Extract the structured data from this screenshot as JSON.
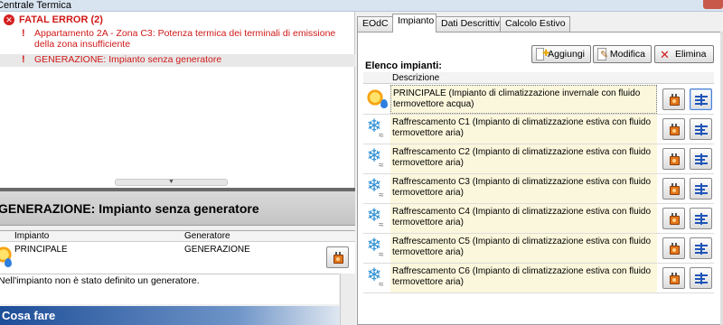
{
  "window": {
    "title": "Centrale Termica"
  },
  "errors": {
    "header": "FATAL ERROR (2)",
    "items": [
      {
        "text": "Appartamento 2A - Zona C3: Potenza termica dei terminali di emissione della zona insufficiente"
      },
      {
        "text": "GENERAZIONE: Impianto senza generatore"
      }
    ]
  },
  "detail": {
    "title": "GENERAZIONE: Impianto senza generatore",
    "columns": {
      "impianto": "Impianto",
      "generatore": "Generatore"
    },
    "row": {
      "impianto": "PRINCIPALE",
      "generatore": "GENERAZIONE"
    },
    "note": "Nell'impianto non è stato definito un generatore.",
    "action_header": "Cosa fare"
  },
  "tabs": [
    "EOdC",
    "Impianto",
    "Dati Descrittivi",
    "Calcolo Estivo"
  ],
  "active_tab": "Impianto",
  "toolbar": {
    "add": "Aggiungi",
    "edit": "Modifica",
    "delete": "Elimina"
  },
  "list": {
    "label": "Elenco impianti:",
    "column": "Descrizione",
    "rows": [
      {
        "icon": "sun-heating-icon",
        "text": "PRINCIPALE (Impianto di climatizzazione invernale con fluido termovettore acqua)"
      },
      {
        "icon": "snowflake-cooling-icon",
        "text": "Raffrescamento C1 (Impianto di climatizzazione estiva con fluido termovettore aria)"
      },
      {
        "icon": "snowflake-cooling-icon",
        "text": "Raffrescamento C2 (Impianto di climatizzazione estiva con fluido termovettore aria)"
      },
      {
        "icon": "snowflake-cooling-icon",
        "text": "Raffrescamento C3 (Impianto di climatizzazione estiva con fluido termovettore aria)"
      },
      {
        "icon": "snowflake-cooling-icon",
        "text": "Raffrescamento C4 (Impianto di climatizzazione estiva con fluido termovettore aria)"
      },
      {
        "icon": "snowflake-cooling-icon",
        "text": "Raffrescamento C5 (Impianto di climatizzazione estiva con fluido termovettore aria)"
      },
      {
        "icon": "snowflake-cooling-icon",
        "text": "Raffrescamento C6 (Impianto di climatizzazione estiva con fluido termovettore aria)"
      }
    ]
  },
  "colors": {
    "error_red": "#d01818",
    "row_highlight": "#fbf7dc",
    "action_blue": "#1e4e98"
  }
}
